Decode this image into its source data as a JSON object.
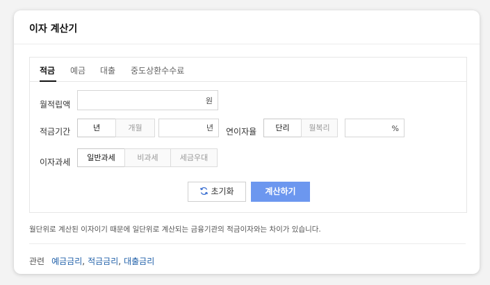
{
  "title": "이자 계산기",
  "tabs": [
    "적금",
    "예금",
    "대출",
    "중도상환수수료"
  ],
  "monthly_deposit": {
    "label": "월적립액",
    "value": "",
    "unit": "원"
  },
  "period": {
    "label": "적금기간",
    "options": [
      "년",
      "개월"
    ],
    "selected": "년",
    "value": "",
    "unit": "년"
  },
  "rate": {
    "label": "연이자율",
    "options": [
      "단리",
      "월복리"
    ],
    "selected": "단리",
    "value": "",
    "unit": "%"
  },
  "tax": {
    "label": "이자과세",
    "options": [
      "일반과세",
      "비과세",
      "세금우대"
    ],
    "selected": "일반과세"
  },
  "buttons": {
    "reset": "초기화",
    "calculate": "계산하기"
  },
  "note": "월단위로 계산된 이자이기 때문에 일단위로 계산되는 금융기관의 적금이자와는 차이가 있습니다.",
  "related": {
    "label": "관련",
    "links": [
      "예금금리",
      "적금금리",
      "대출금리"
    ]
  },
  "colors": {
    "accent": "#6c97ef",
    "link": "#1f5fa8"
  }
}
